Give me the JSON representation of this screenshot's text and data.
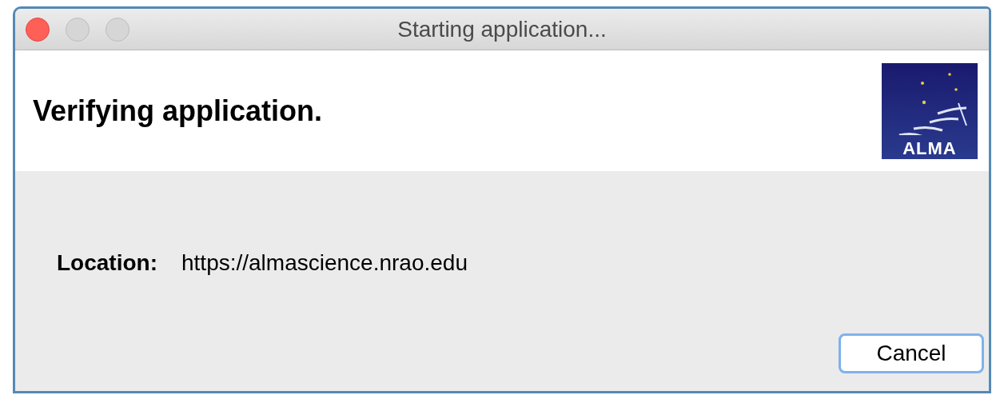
{
  "window": {
    "title": "Starting application...",
    "controls": [
      {
        "kind": "close"
      },
      {
        "kind": "minimize"
      },
      {
        "kind": "zoom"
      }
    ]
  },
  "header": {
    "heading": "Verifying application.",
    "logo": {
      "text": "ALMA"
    }
  },
  "details": [
    {
      "label": "Location:",
      "value": "https://almascience.nrao.edu"
    }
  ],
  "buttons": [
    {
      "label": "Cancel",
      "default": true
    }
  ]
}
